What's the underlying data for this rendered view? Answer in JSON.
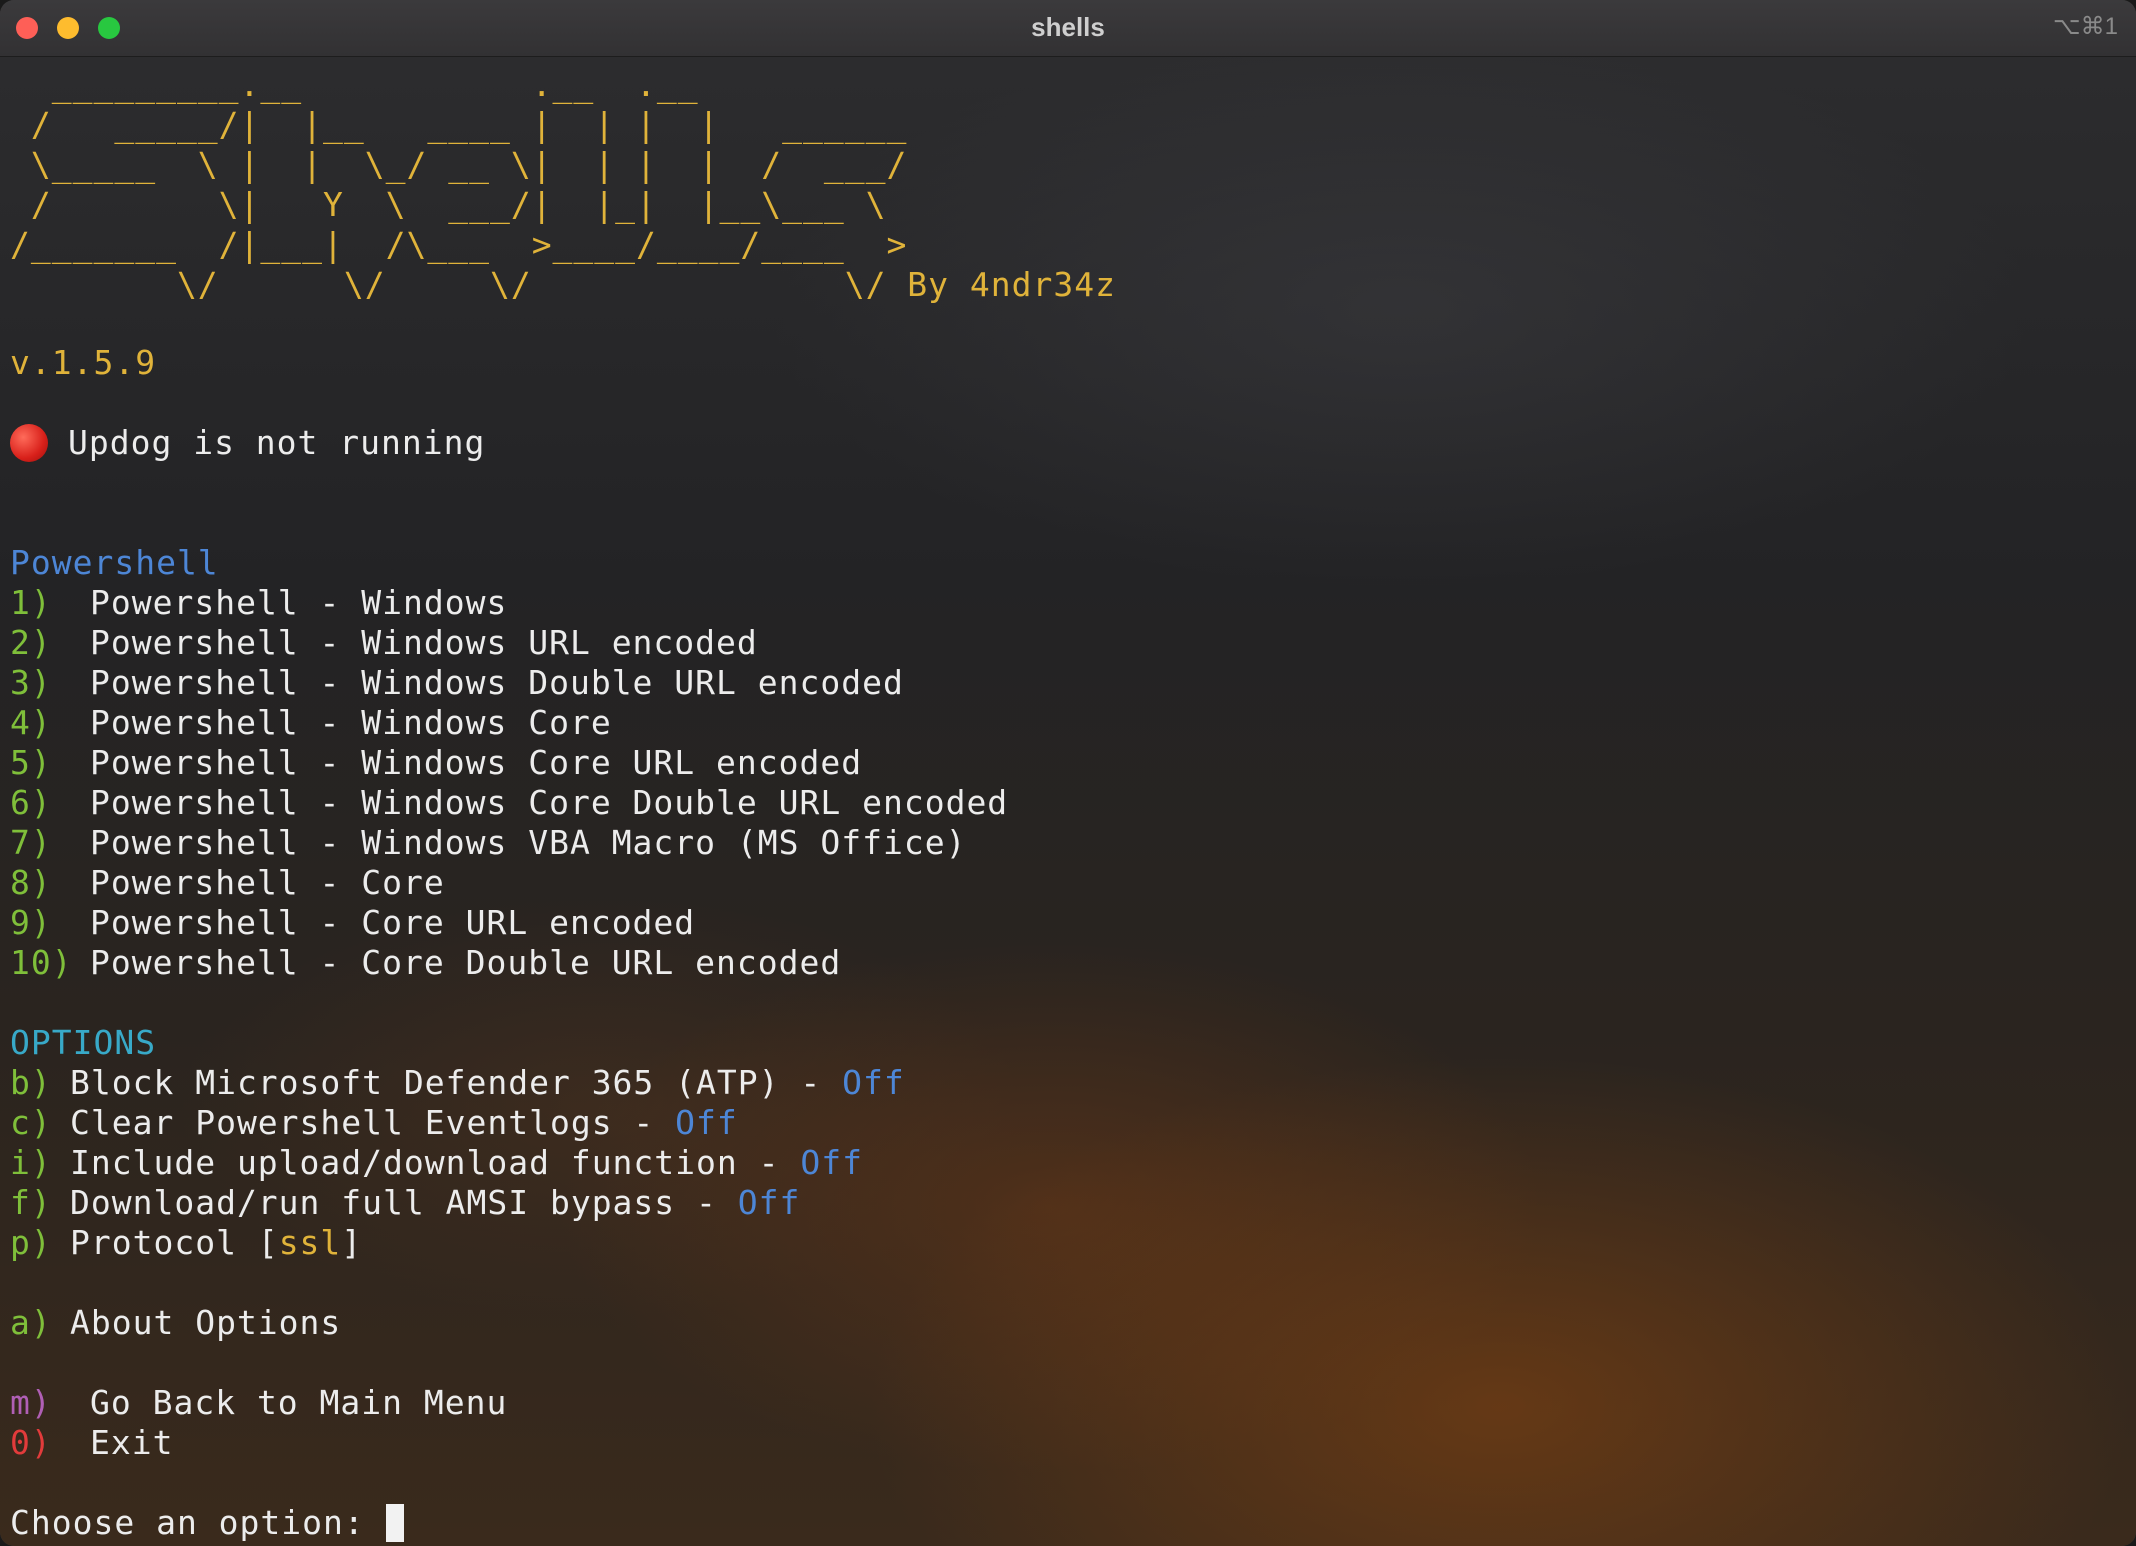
{
  "window": {
    "title": "shells",
    "shortcut": "⌥⌘1"
  },
  "banner": {
    "lines": [
      "  _________.__           .__  .__",
      " /   _____/|  |__   ____ |  | |  |   ______",
      " \\_____  \\ |  |  \\_/ __ \\|  | |  |  /  ___/",
      " /        \\|   Y  \\  ___/|  |_|  |__\\___ \\",
      "/_______  /|___|  /\\___  >____/____/____  >",
      "        \\/      \\/     \\/               \\/ By 4ndr34z"
    ]
  },
  "version": "v.1.5.9",
  "updog_status": "Updog is not running",
  "powershell": {
    "heading": "Powershell",
    "items": [
      {
        "key": "1)",
        "label": "Powershell - Windows"
      },
      {
        "key": "2)",
        "label": "Powershell - Windows URL encoded"
      },
      {
        "key": "3)",
        "label": "Powershell - Windows Double URL encoded"
      },
      {
        "key": "4)",
        "label": "Powershell - Windows Core"
      },
      {
        "key": "5)",
        "label": "Powershell - Windows Core URL encoded"
      },
      {
        "key": "6)",
        "label": "Powershell - Windows Core Double URL encoded"
      },
      {
        "key": "7)",
        "label": "Powershell - Windows VBA Macro (MS Office)"
      },
      {
        "key": "8)",
        "label": "Powershell - Core"
      },
      {
        "key": "9)",
        "label": "Powershell - Core URL encoded"
      },
      {
        "key": "10)",
        "label": "Powershell - Core Double URL encoded"
      }
    ]
  },
  "options": {
    "heading": "OPTIONS",
    "items": [
      {
        "key": "b)",
        "label": "Block Microsoft Defender 365 (ATP) - ",
        "value": "Off"
      },
      {
        "key": "c)",
        "label": "Clear Powershell Eventlogs - ",
        "value": "Off"
      },
      {
        "key": "i)",
        "label": "Include upload/download function - ",
        "value": "Off"
      },
      {
        "key": "f)",
        "label": "Download/run full AMSI bypass - ",
        "value": "Off"
      },
      {
        "key": "p)",
        "label": "Protocol [",
        "value": "ssl",
        "suffix": "]"
      }
    ],
    "about": {
      "key": "a)",
      "label": "About Options"
    }
  },
  "navigation": {
    "main_menu": {
      "key": "m)",
      "label": "Go Back to Main Menu"
    },
    "exit": {
      "key": "0)",
      "label": "Exit"
    }
  },
  "prompt": "Choose an option: ",
  "colors": {
    "banner": "#e0b33a",
    "heading_powershell": "#4d86d6",
    "heading_options": "#38a9c8",
    "key_green": "#7fbf3a",
    "key_menu": "#b05fb5",
    "key_exit": "#e23b3b",
    "value_off": "#4d86d6"
  }
}
